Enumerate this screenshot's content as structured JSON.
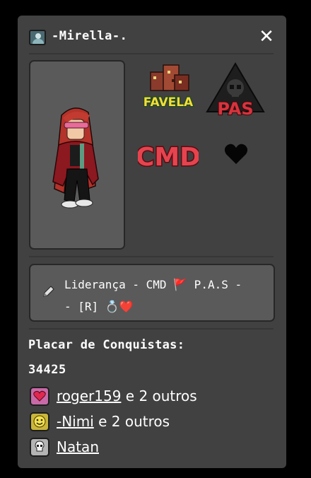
{
  "profile": {
    "username": "-Mirella-.",
    "close_glyph": "✕",
    "user_icon": "user-avatar-icon"
  },
  "badges": [
    {
      "name": "favela",
      "text": "FAVELA"
    },
    {
      "name": "pas",
      "text": "PAS"
    },
    {
      "name": "cmd",
      "text": "CMD"
    },
    {
      "name": "heart",
      "text": ""
    }
  ],
  "motto": {
    "icon": "pencil-icon",
    "text": "Liderança - CMD 🚩 P.A.S -\n- [R] 💍❤️"
  },
  "achievements": {
    "title": "Placar de Conquistas:",
    "score": "34425",
    "items": [
      {
        "icon": "heart-icon",
        "icon_bg": "#c86aa8",
        "user": "roger159",
        "suffix": " e 2 outros"
      },
      {
        "icon": "smiley-icon",
        "icon_bg": "#c9b63a",
        "user": "-Nimi",
        "suffix": " e 2 outros"
      },
      {
        "icon": "skull-icon",
        "icon_bg": "#b4b4b4",
        "user": "Natan",
        "suffix": ""
      }
    ]
  },
  "colors": {
    "card": "#414141",
    "panel": "#5a5a5a",
    "accent_red": "#d8333d"
  }
}
